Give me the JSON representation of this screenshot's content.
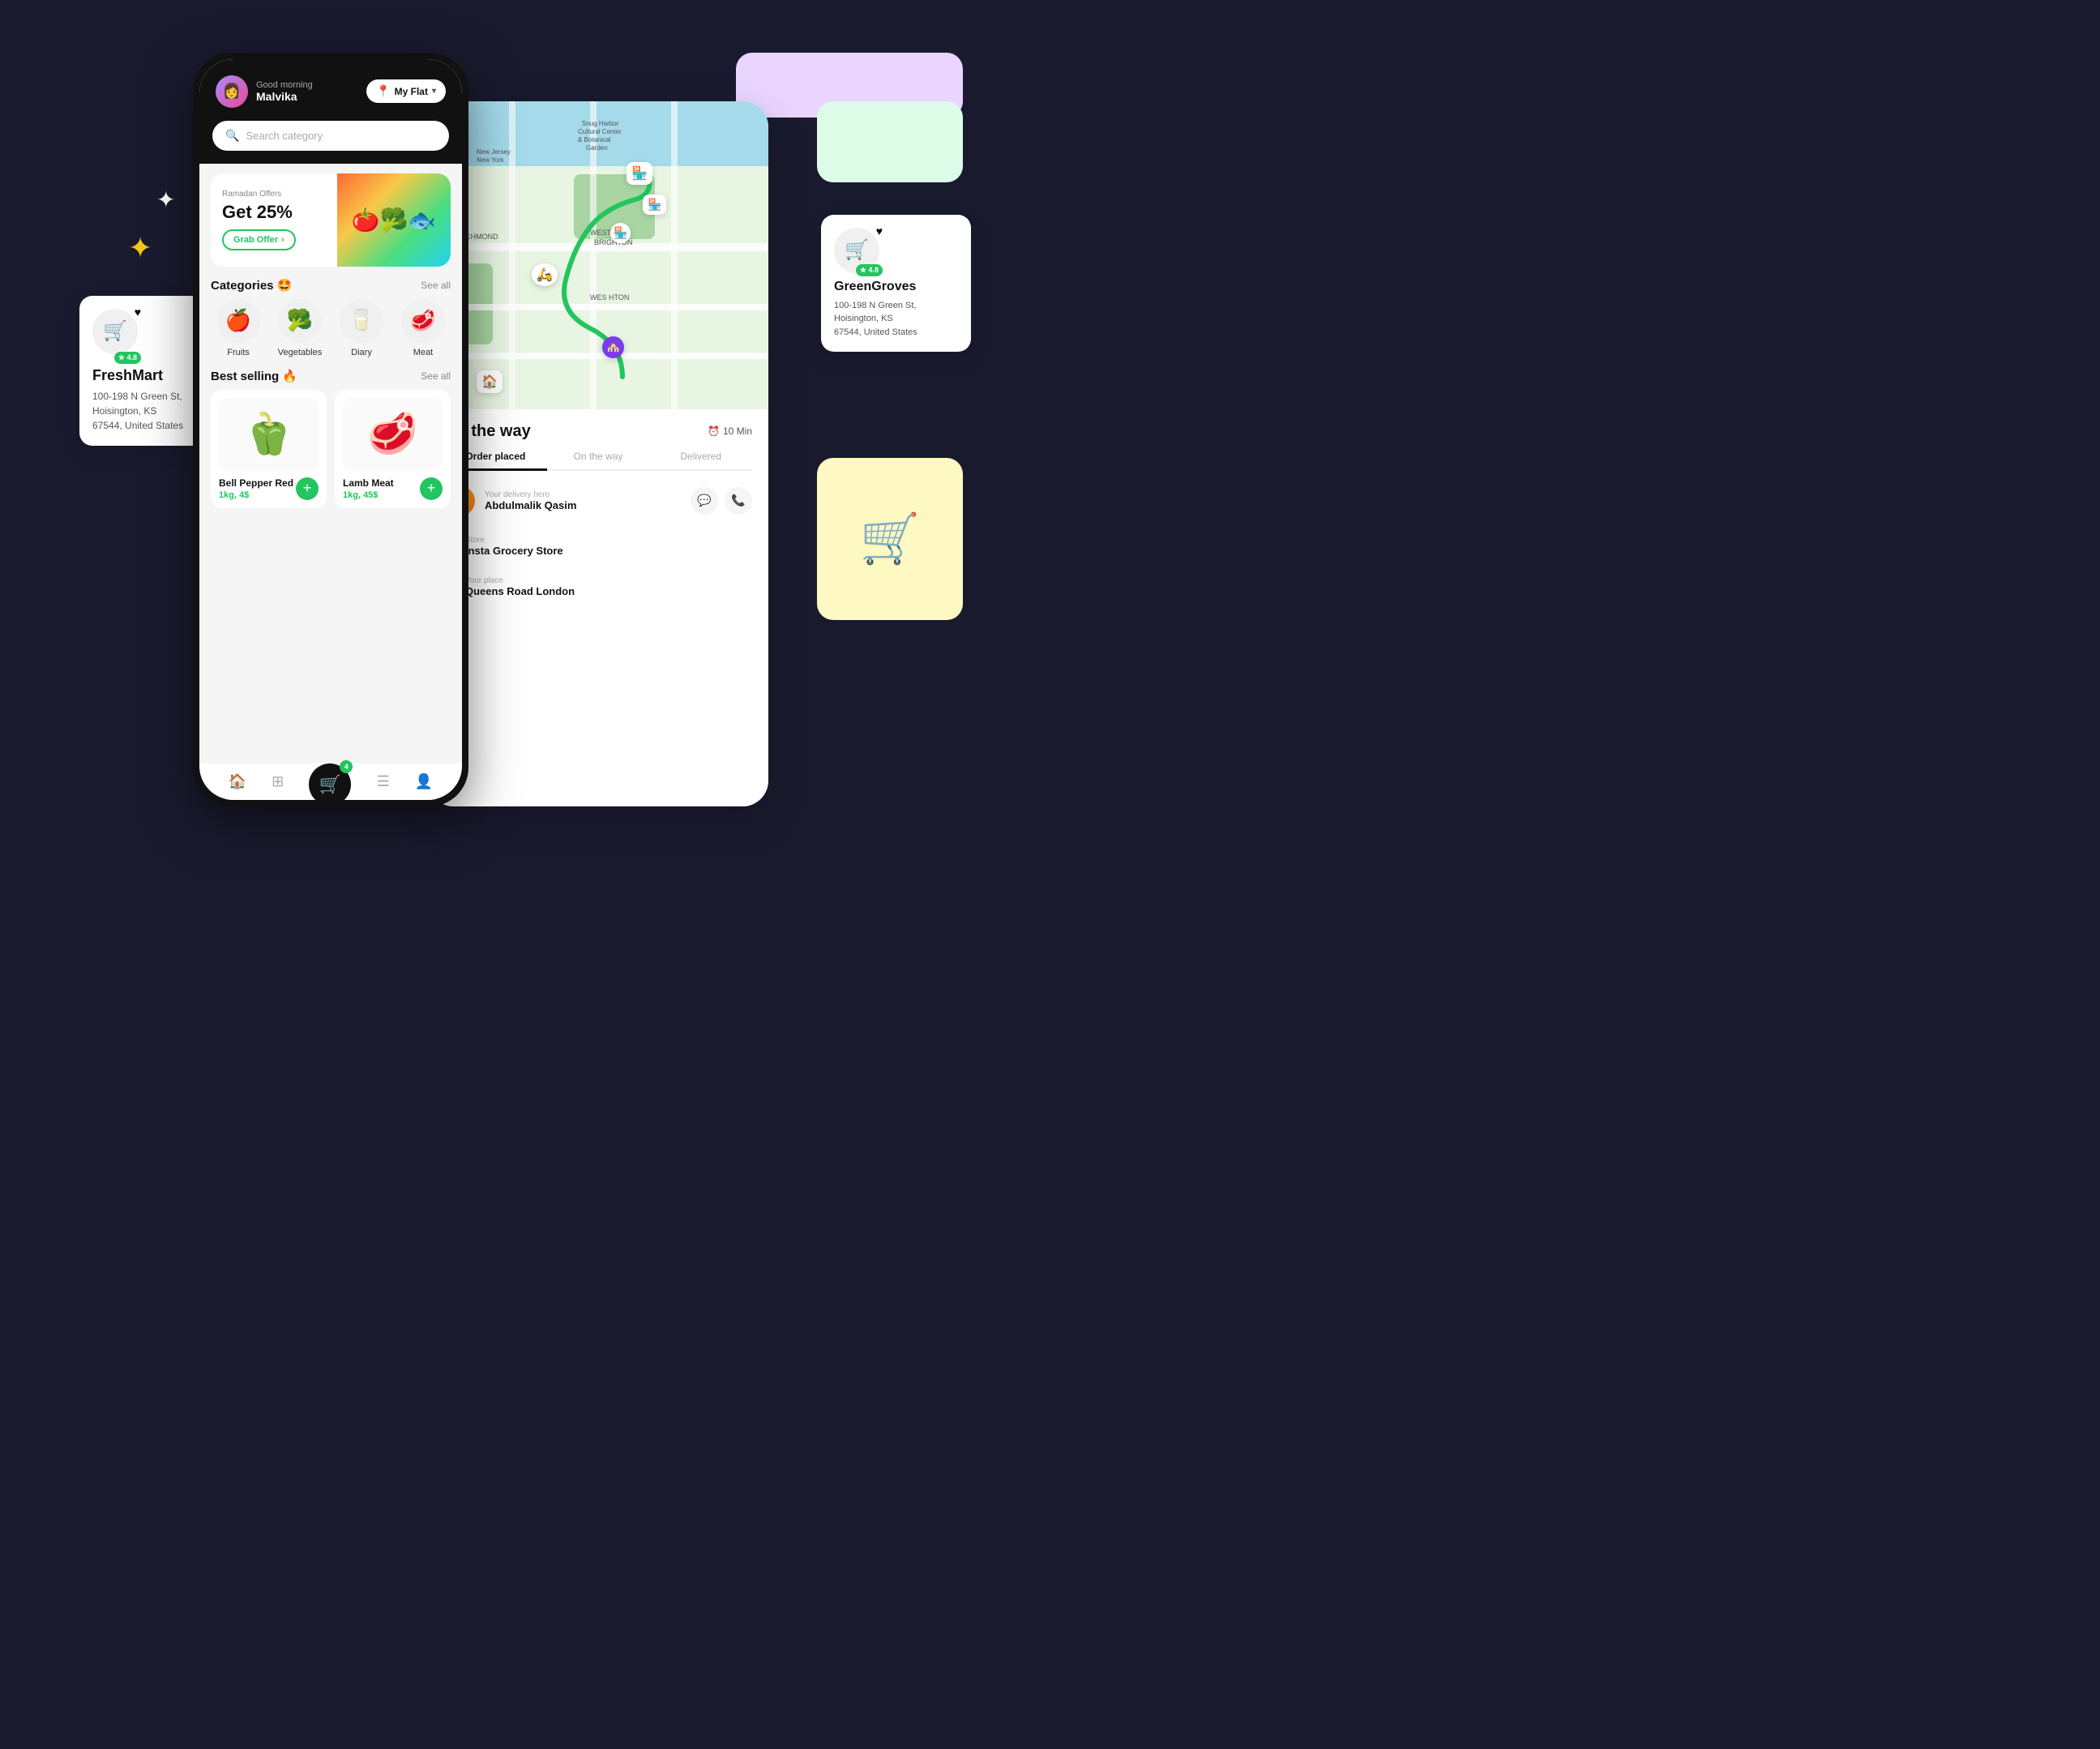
{
  "scene": {
    "decorations": {
      "star_gold": "✦",
      "star_white": "✦"
    }
  },
  "left_store_card": {
    "icon": "🛒",
    "heart": "♥",
    "rating": "★ 4.8",
    "name": "FreshMart",
    "address": "100-198 N Green St,\nHoisington, KS\n67544, United States"
  },
  "phone": {
    "header": {
      "greeting": "Good morning",
      "username": "Malvika",
      "location_label": "My Flat",
      "avatar_emoji": "👩"
    },
    "search": {
      "placeholder": "Search category",
      "icon": "🔍"
    },
    "banner": {
      "label": "Ramadan Offers",
      "title": "Get 25%",
      "button_label": "Grab Offer",
      "image_emoji": "🥦🍅🐟"
    },
    "categories": {
      "title": "Categories",
      "emoji": "🤩",
      "see_all": "See all",
      "items": [
        {
          "icon": "🍎",
          "label": "Fruits"
        },
        {
          "icon": "🥦",
          "label": "Vegetables"
        },
        {
          "icon": "🥛",
          "label": "Diary"
        },
        {
          "icon": "🥩",
          "label": "Meat"
        }
      ]
    },
    "best_selling": {
      "title": "Best selling",
      "emoji": "🔥",
      "see_all": "See all",
      "products": [
        {
          "name": "Bell Pepper Red",
          "price": "1kg, 4$",
          "emoji": "🫑"
        },
        {
          "name": "Lamb Meat",
          "price": "1kg, 45$",
          "emoji": "🥩"
        }
      ]
    },
    "bottom_nav": {
      "home": "🏠",
      "grid": "⊞",
      "cart": "🛒",
      "cart_badge": "4",
      "menu": "☰",
      "profile": "👤"
    }
  },
  "tracking": {
    "back_btn": "‹",
    "map": {
      "markers": {
        "store1": "🏪",
        "store2": "🏪",
        "store3": "🏪",
        "rider": "🛵",
        "destination": "🏘️"
      }
    },
    "title": "On the way",
    "time_icon": "⏰",
    "time": "10 Min",
    "steps": [
      {
        "label": "Order placed",
        "active": true
      },
      {
        "label": "On the way",
        "active": false
      },
      {
        "label": "Delivered",
        "active": false
      }
    ],
    "delivery_hero": {
      "label": "Your delivery hero",
      "name": "Abdulmalik Qasim",
      "avatar": "👨"
    },
    "store": {
      "label": "Store",
      "name": "Insta Grocery Store"
    },
    "place": {
      "label": "Your place",
      "name": "Queens Road London"
    },
    "actions": {
      "chat": "💬",
      "call": "📞"
    }
  },
  "right_store_card": {
    "icon": "🛒",
    "heart": "♥",
    "rating": "★ 4.8",
    "name": "GreenGroves",
    "address": "100-198 N Green St,\nHoisington, KS\n67544, United States"
  }
}
